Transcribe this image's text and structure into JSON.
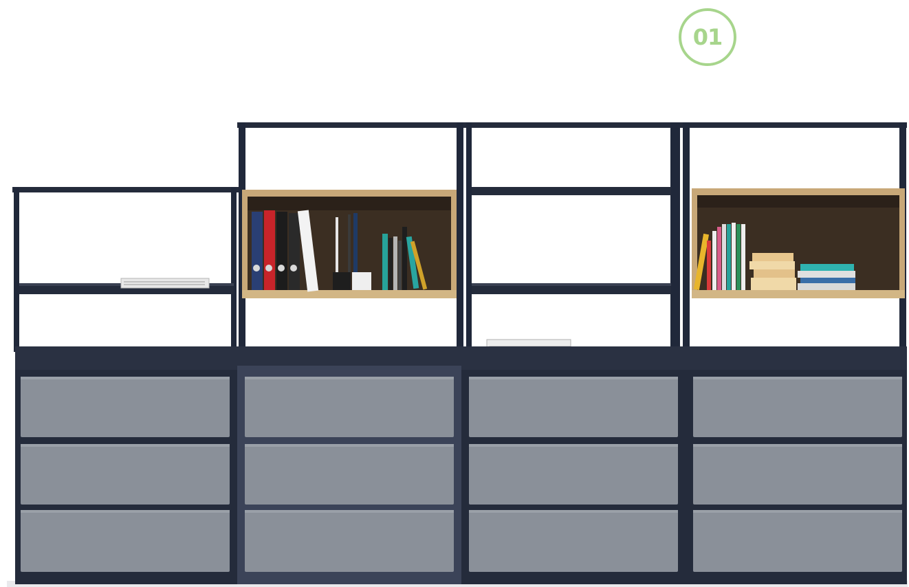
{
  "badge": {
    "number": "01"
  },
  "colors": {
    "frame": "#20283a",
    "drawer_face": "#8a9099",
    "cabinet_body": "#242b3b",
    "oak": "#c8a878",
    "accent_badge": "#a7d58c"
  },
  "scene": {
    "units": [
      {
        "name": "left-low-unit",
        "open_shelves": 2,
        "drawers": 3
      },
      {
        "name": "unit-2",
        "open_shelves": 3,
        "drawers": 3,
        "wood_box": true,
        "box_contents": "binders-and-books"
      },
      {
        "name": "unit-3",
        "open_shelves": 3,
        "drawers": 3,
        "surface_item": "magazines"
      },
      {
        "name": "unit-4",
        "open_shelves": 3,
        "drawers": 3,
        "wood_box": true,
        "box_contents": "books"
      }
    ]
  }
}
